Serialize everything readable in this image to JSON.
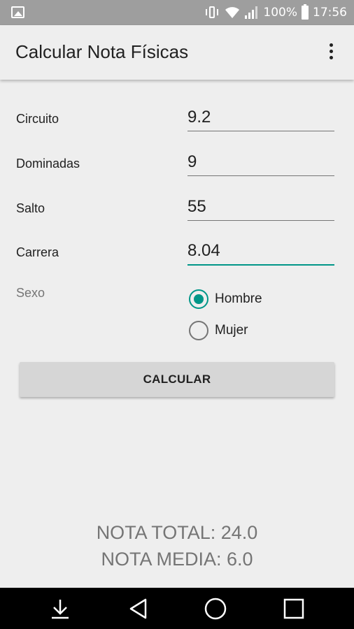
{
  "status_bar": {
    "battery": "100%",
    "time": "17:56",
    "icons": [
      "image-icon",
      "vibrate-icon",
      "wifi-icon",
      "signal-icon",
      "battery-icon"
    ]
  },
  "app_bar": {
    "title": "Calcular Nota Físicas",
    "menu_icon": "more-vert-icon"
  },
  "form": {
    "fields": [
      {
        "label": "Circuito",
        "value": "9.2"
      },
      {
        "label": "Dominadas",
        "value": "9"
      },
      {
        "label": "Salto",
        "value": "55"
      },
      {
        "label": "Carrera",
        "value": "8.04"
      }
    ],
    "sexo": {
      "label": "Sexo",
      "options": [
        {
          "label": "Hombre",
          "checked": true
        },
        {
          "label": "Mujer",
          "checked": false
        }
      ]
    },
    "calc_button": "CALCULAR"
  },
  "results": {
    "total": "NOTA TOTAL: 24.0",
    "media": "NOTA MEDIA: 6.0"
  },
  "nav_bar": {
    "icons": [
      "download-icon",
      "back-icon",
      "home-icon",
      "recents-icon"
    ]
  },
  "colors": {
    "accent": "#009688",
    "status_bar": "#9e9e9e",
    "background": "#eeeeee"
  }
}
